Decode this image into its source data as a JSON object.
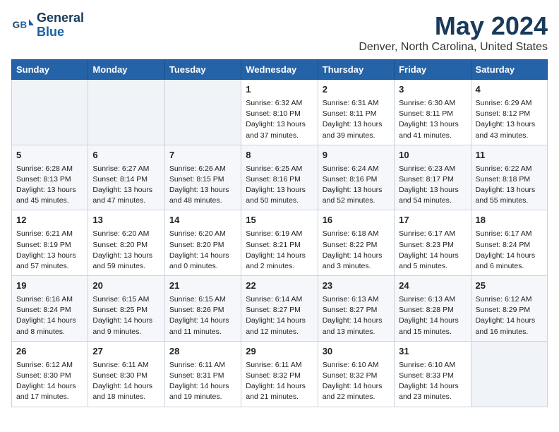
{
  "header": {
    "logo_line1": "General",
    "logo_line2": "Blue",
    "month_year": "May 2024",
    "location": "Denver, North Carolina, United States"
  },
  "weekdays": [
    "Sunday",
    "Monday",
    "Tuesday",
    "Wednesday",
    "Thursday",
    "Friday",
    "Saturday"
  ],
  "weeks": [
    [
      {
        "day": null,
        "info": null
      },
      {
        "day": null,
        "info": null
      },
      {
        "day": null,
        "info": null
      },
      {
        "day": "1",
        "info": "Sunrise: 6:32 AM\nSunset: 8:10 PM\nDaylight: 13 hours\nand 37 minutes."
      },
      {
        "day": "2",
        "info": "Sunrise: 6:31 AM\nSunset: 8:11 PM\nDaylight: 13 hours\nand 39 minutes."
      },
      {
        "day": "3",
        "info": "Sunrise: 6:30 AM\nSunset: 8:11 PM\nDaylight: 13 hours\nand 41 minutes."
      },
      {
        "day": "4",
        "info": "Sunrise: 6:29 AM\nSunset: 8:12 PM\nDaylight: 13 hours\nand 43 minutes."
      }
    ],
    [
      {
        "day": "5",
        "info": "Sunrise: 6:28 AM\nSunset: 8:13 PM\nDaylight: 13 hours\nand 45 minutes."
      },
      {
        "day": "6",
        "info": "Sunrise: 6:27 AM\nSunset: 8:14 PM\nDaylight: 13 hours\nand 47 minutes."
      },
      {
        "day": "7",
        "info": "Sunrise: 6:26 AM\nSunset: 8:15 PM\nDaylight: 13 hours\nand 48 minutes."
      },
      {
        "day": "8",
        "info": "Sunrise: 6:25 AM\nSunset: 8:16 PM\nDaylight: 13 hours\nand 50 minutes."
      },
      {
        "day": "9",
        "info": "Sunrise: 6:24 AM\nSunset: 8:16 PM\nDaylight: 13 hours\nand 52 minutes."
      },
      {
        "day": "10",
        "info": "Sunrise: 6:23 AM\nSunset: 8:17 PM\nDaylight: 13 hours\nand 54 minutes."
      },
      {
        "day": "11",
        "info": "Sunrise: 6:22 AM\nSunset: 8:18 PM\nDaylight: 13 hours\nand 55 minutes."
      }
    ],
    [
      {
        "day": "12",
        "info": "Sunrise: 6:21 AM\nSunset: 8:19 PM\nDaylight: 13 hours\nand 57 minutes."
      },
      {
        "day": "13",
        "info": "Sunrise: 6:20 AM\nSunset: 8:20 PM\nDaylight: 13 hours\nand 59 minutes."
      },
      {
        "day": "14",
        "info": "Sunrise: 6:20 AM\nSunset: 8:20 PM\nDaylight: 14 hours\nand 0 minutes."
      },
      {
        "day": "15",
        "info": "Sunrise: 6:19 AM\nSunset: 8:21 PM\nDaylight: 14 hours\nand 2 minutes."
      },
      {
        "day": "16",
        "info": "Sunrise: 6:18 AM\nSunset: 8:22 PM\nDaylight: 14 hours\nand 3 minutes."
      },
      {
        "day": "17",
        "info": "Sunrise: 6:17 AM\nSunset: 8:23 PM\nDaylight: 14 hours\nand 5 minutes."
      },
      {
        "day": "18",
        "info": "Sunrise: 6:17 AM\nSunset: 8:24 PM\nDaylight: 14 hours\nand 6 minutes."
      }
    ],
    [
      {
        "day": "19",
        "info": "Sunrise: 6:16 AM\nSunset: 8:24 PM\nDaylight: 14 hours\nand 8 minutes."
      },
      {
        "day": "20",
        "info": "Sunrise: 6:15 AM\nSunset: 8:25 PM\nDaylight: 14 hours\nand 9 minutes."
      },
      {
        "day": "21",
        "info": "Sunrise: 6:15 AM\nSunset: 8:26 PM\nDaylight: 14 hours\nand 11 minutes."
      },
      {
        "day": "22",
        "info": "Sunrise: 6:14 AM\nSunset: 8:27 PM\nDaylight: 14 hours\nand 12 minutes."
      },
      {
        "day": "23",
        "info": "Sunrise: 6:13 AM\nSunset: 8:27 PM\nDaylight: 14 hours\nand 13 minutes."
      },
      {
        "day": "24",
        "info": "Sunrise: 6:13 AM\nSunset: 8:28 PM\nDaylight: 14 hours\nand 15 minutes."
      },
      {
        "day": "25",
        "info": "Sunrise: 6:12 AM\nSunset: 8:29 PM\nDaylight: 14 hours\nand 16 minutes."
      }
    ],
    [
      {
        "day": "26",
        "info": "Sunrise: 6:12 AM\nSunset: 8:30 PM\nDaylight: 14 hours\nand 17 minutes."
      },
      {
        "day": "27",
        "info": "Sunrise: 6:11 AM\nSunset: 8:30 PM\nDaylight: 14 hours\nand 18 minutes."
      },
      {
        "day": "28",
        "info": "Sunrise: 6:11 AM\nSunset: 8:31 PM\nDaylight: 14 hours\nand 19 minutes."
      },
      {
        "day": "29",
        "info": "Sunrise: 6:11 AM\nSunset: 8:32 PM\nDaylight: 14 hours\nand 21 minutes."
      },
      {
        "day": "30",
        "info": "Sunrise: 6:10 AM\nSunset: 8:32 PM\nDaylight: 14 hours\nand 22 minutes."
      },
      {
        "day": "31",
        "info": "Sunrise: 6:10 AM\nSunset: 8:33 PM\nDaylight: 14 hours\nand 23 minutes."
      },
      {
        "day": null,
        "info": null
      }
    ]
  ]
}
